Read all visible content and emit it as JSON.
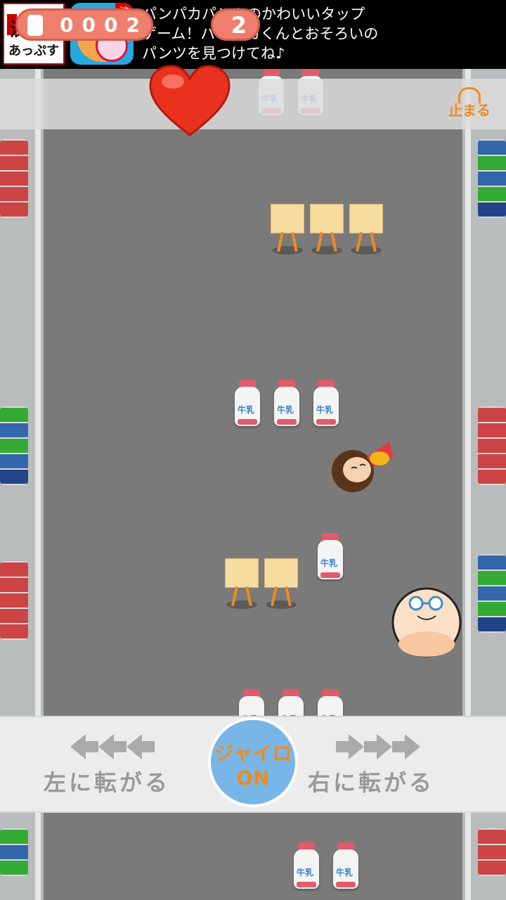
{
  "ad": {
    "logo_line1": "渋三",
    "logo_line2": "あっぷす",
    "badge": "渋",
    "text_lines": [
      "パンパカパンツのかわいいタップ",
      "ゲーム！パンパカくんとおそろいの",
      "パンツを見つけてね♪"
    ]
  },
  "hud": {
    "milk_count": "0002",
    "lives": "2",
    "stop_label": "止まる"
  },
  "controls": {
    "left_label": "左に転がる",
    "right_label": "右に転がる",
    "gyro_line1": "ジャイロ",
    "gyro_line2": "ON"
  },
  "colors": {
    "accent": "#f08a1e",
    "counter_bg": "#f07e6c",
    "gyro_bg": "#78b6e8",
    "road": "#7a7a7a"
  },
  "icons": [
    "milk-bottle-icon",
    "heart-icon",
    "pause-icon",
    "left-arrows-icon",
    "right-arrows-icon"
  ]
}
